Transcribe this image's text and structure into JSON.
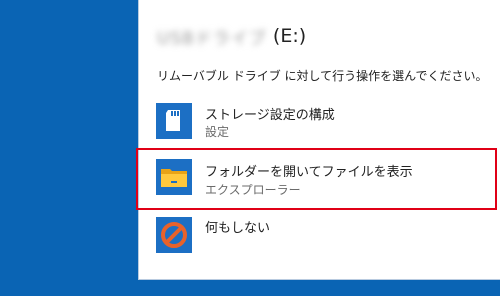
{
  "dialog": {
    "drive_name_blurred": "USBドライブ",
    "drive_letter": "(E:)",
    "prompt": "リムーバブル ドライブ に対して行う操作を選んでください。"
  },
  "options": [
    {
      "title": "ストレージ設定の構成",
      "subtitle": "設定",
      "icon": "sd-card-icon"
    },
    {
      "title": "フォルダーを開いてファイルを表示",
      "subtitle": "エクスプローラー",
      "icon": "folder-icon",
      "highlighted": true
    },
    {
      "title": "何もしない",
      "icon": "no-action-icon"
    }
  ],
  "colors": {
    "desktop": "#0a64b4",
    "highlight": "#e00016",
    "icon_blue": "#1c6fc4"
  }
}
